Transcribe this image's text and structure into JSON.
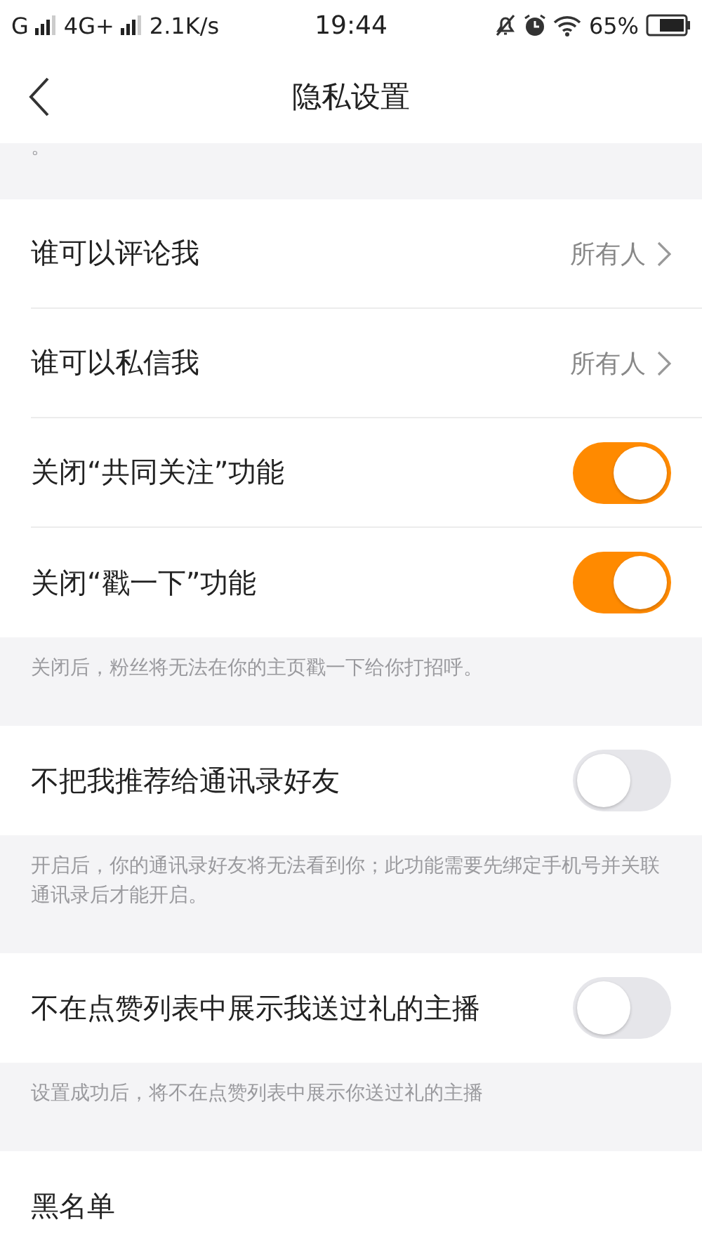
{
  "status_bar": {
    "network_1": "G",
    "network_2": "4G+",
    "speed": "2.1K/s",
    "time": "19:44",
    "battery": "65%"
  },
  "nav": {
    "title": "隐私设置"
  },
  "sections": [
    {
      "kind": "note",
      "text": "。"
    },
    {
      "kind": "group",
      "items": [
        {
          "kind": "link",
          "label": "谁可以评论我",
          "value": "所有人"
        },
        {
          "kind": "link",
          "label": "谁可以私信我",
          "value": "所有人"
        },
        {
          "kind": "toggle",
          "label": "关闭“共同关注”功能",
          "on": true
        },
        {
          "kind": "toggle",
          "label": "关闭“戳一下”功能",
          "on": true
        }
      ]
    },
    {
      "kind": "note",
      "text": "关闭后，粉丝将无法在你的主页戳一下给你打招呼。"
    },
    {
      "kind": "group",
      "items": [
        {
          "kind": "toggle",
          "label": "不把我推荐给通讯录好友",
          "on": false
        }
      ]
    },
    {
      "kind": "note",
      "text": "开启后，你的通讯录好友将无法看到你；此功能需要先绑定手机号并关联通讯录后才能开启。"
    },
    {
      "kind": "group",
      "items": [
        {
          "kind": "toggle",
          "label": "不在点赞列表中展示我送过礼的主播",
          "on": false
        }
      ]
    },
    {
      "kind": "note",
      "text": "设置成功后，将不在点赞列表中展示你送过礼的主播"
    },
    {
      "kind": "group",
      "items": [
        {
          "kind": "link",
          "label": "黑名单"
        }
      ]
    }
  ]
}
